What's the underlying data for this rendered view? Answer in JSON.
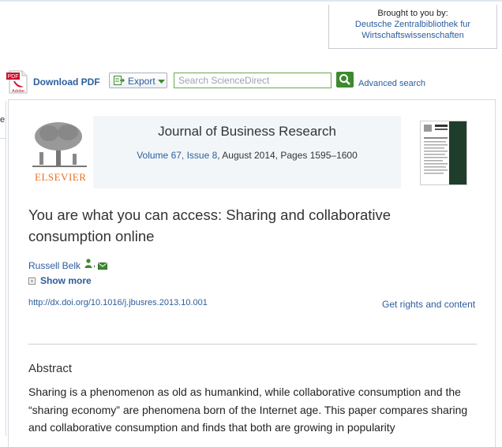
{
  "header": {
    "brought_by": "Brought to you by:",
    "institution_line1": "Deutsche Zentralbibliothek fur",
    "institution_line2": "Wirtschaftswissenschaften"
  },
  "toolbar": {
    "download_pdf": "Download PDF",
    "export_label": "Export",
    "search_placeholder": "Search ScienceDirect",
    "advanced_search": "Advanced search",
    "pdf_icon_text_top": "PDF",
    "pdf_icon_text_bottom": "Adobe"
  },
  "left_panel": {
    "fragment": "e"
  },
  "journal": {
    "publisher": "ELSEVIER",
    "title": "Journal of Business Research",
    "volume_issue_link": "Volume 67, Issue 8",
    "date_pages": ", August 2014, Pages 1595–1600"
  },
  "article": {
    "title": "You are what you can access: Sharing and collaborative consumption online",
    "author": "Russell Belk",
    "author_separator": ",",
    "show_more": "Show more",
    "doi": "http://dx.doi.org/10.1016/j.jbusres.2013.10.001",
    "rights": "Get rights and content",
    "abstract_heading": "Abstract",
    "abstract_text": "Sharing is a phenomenon as old as humankind, while collaborative consumption and the “sharing economy” are phenomena born of the Internet age. This paper compares sharing and collaborative consumption and finds that both are growing in popularity"
  },
  "icons": {
    "pdf": "pdf-file-icon",
    "export": "export-icon",
    "caret": "chevron-down-icon",
    "search": "search-icon",
    "person": "person-icon",
    "mail": "mail-icon",
    "expand": "plus-icon"
  },
  "colors": {
    "link": "#2b5d9c",
    "search_green": "#3d8a2e",
    "elsevier_orange": "#e9711c"
  }
}
